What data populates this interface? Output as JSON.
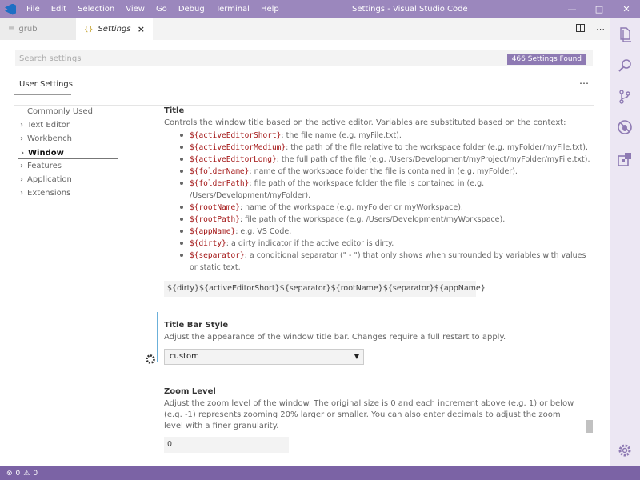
{
  "titlebar": {
    "menu": [
      "File",
      "Edit",
      "Selection",
      "View",
      "Go",
      "Debug",
      "Terminal",
      "Help"
    ],
    "title": "Settings - Visual Studio Code"
  },
  "tabs": [
    {
      "label": "grub",
      "active": false
    },
    {
      "label": "Settings",
      "icon": "{}",
      "active": true,
      "close": "×"
    }
  ],
  "search": {
    "placeholder": "Search settings",
    "badge": "466 Settings Found"
  },
  "settings_tab": "User Settings",
  "toc": [
    "Commonly Used",
    "Text Editor",
    "Workbench",
    "Window",
    "Features",
    "Application",
    "Extensions"
  ],
  "title_setting": {
    "name": "Title",
    "desc": "Controls the window title based on the active editor. Variables are substituted based on the context:",
    "vars": [
      {
        "code": "${activeEditorShort}",
        "text": ": the file name (e.g. myFile.txt)."
      },
      {
        "code": "${activeEditorMedium}",
        "text": ": the path of the file relative to the workspace folder (e.g. myFolder/myFile.txt)."
      },
      {
        "code": "${activeEditorLong}",
        "text": ": the full path of the file (e.g. /Users/Development/myProject/myFolder/myFile.txt)."
      },
      {
        "code": "${folderName}",
        "text": ": name of the workspace folder the file is contained in (e.g. myFolder)."
      },
      {
        "code": "${folderPath}",
        "text": ": file path of the workspace folder the file is contained in (e.g. /Users/Development/myFolder)."
      },
      {
        "code": "${rootName}",
        "text": ": name of the workspace (e.g. myFolder or myWorkspace)."
      },
      {
        "code": "${rootPath}",
        "text": ": file path of the workspace (e.g. /Users/Development/myWorkspace)."
      },
      {
        "code": "${appName}",
        "text": ": e.g. VS Code."
      },
      {
        "code": "${dirty}",
        "text": ": a dirty indicator if the active editor is dirty."
      },
      {
        "code": "${separator}",
        "text": ": a conditional separator (\" - \") that only shows when surrounded by variables with values or static text."
      }
    ],
    "value": "${dirty}${activeEditorShort}${separator}${rootName}${separator}${appName}"
  },
  "titlebar_setting": {
    "name": "Title Bar Style",
    "desc": "Adjust the appearance of the window title bar. Changes require a full restart to apply.",
    "value": "custom"
  },
  "zoom_setting": {
    "name": "Zoom Level",
    "desc": "Adjust the zoom level of the window. The original size is 0 and each increment above (e.g. 1) or below (e.g. -1) represents zooming 20% larger or smaller. You can also enter decimals to adjust the zoom level with a finer granularity.",
    "value": "0"
  },
  "status": {
    "errors": "0",
    "warnings": "0"
  }
}
